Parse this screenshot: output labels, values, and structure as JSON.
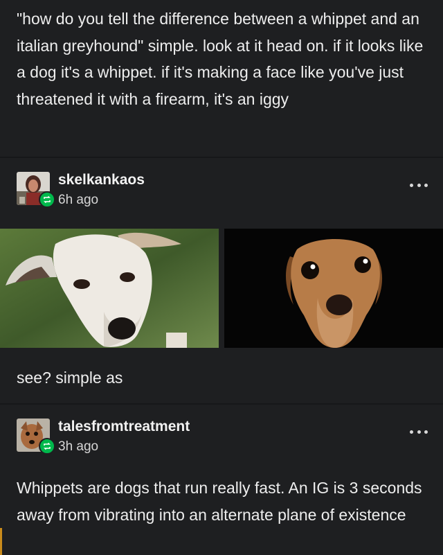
{
  "post": {
    "body_text": "\"how do you tell the difference between a whippet and an italian greyhound\" simple. look at it head on. if it looks like a dog it's a whippet. if it's making a face like you've just threatened it with a firearm, it's an iggy"
  },
  "reblogs": [
    {
      "username": "skelkankaos",
      "time": "6h ago",
      "body_text": "see? simple as",
      "images": [
        {
          "subject": "white whippet head-on photo"
        },
        {
          "subject": "tan italian greyhound wide-eyed photo"
        }
      ]
    },
    {
      "username": "talesfromtreatment",
      "time": "3h ago",
      "body_text": "Whippets are dogs that run really fast. An IG is 3 seconds away from vibrating into an alternate plane of existence"
    }
  ],
  "icons": {
    "more": "more-options-icon",
    "reblog": "reblog-icon"
  },
  "colors": {
    "background": "#1e1f21",
    "text": "#eeeeee",
    "reblog_badge": "#00b84c",
    "divider": "#161719"
  }
}
